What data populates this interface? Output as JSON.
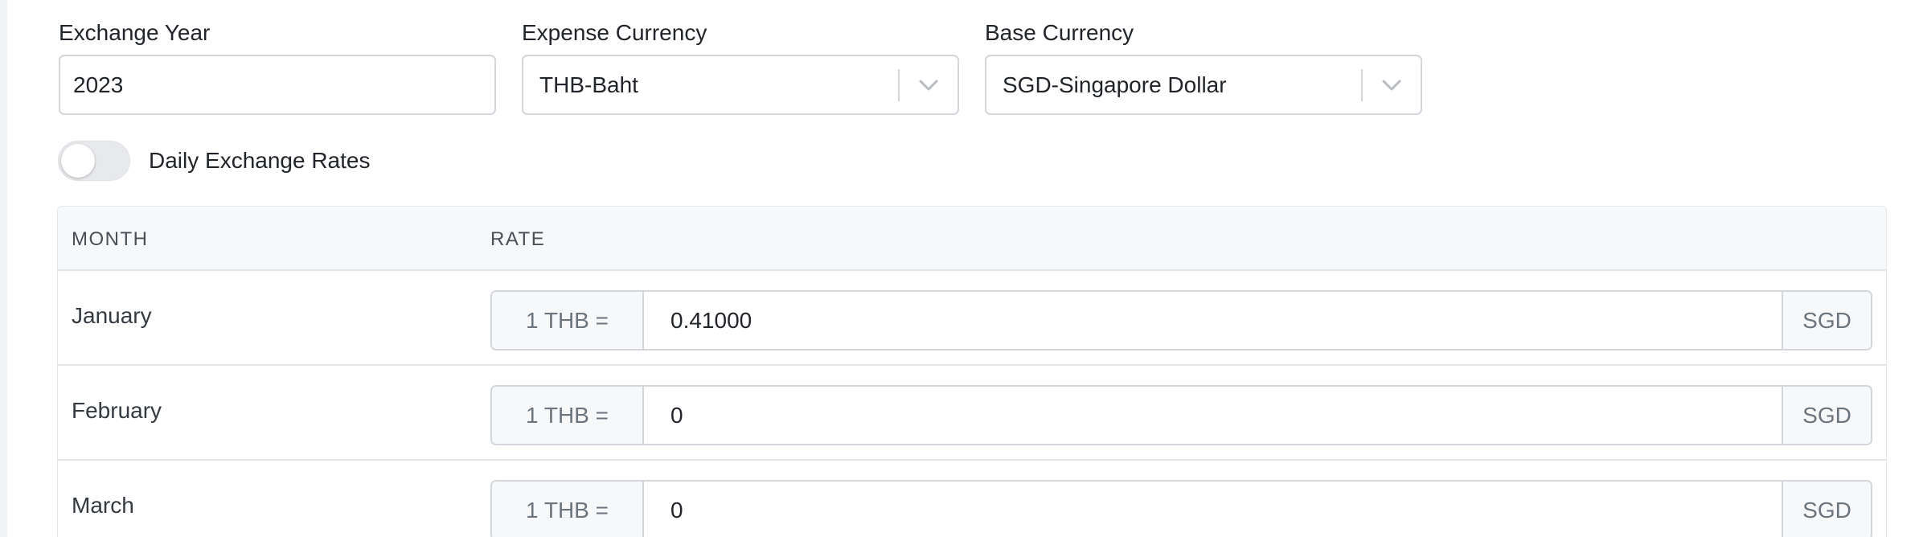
{
  "form": {
    "exchange_year": {
      "label": "Exchange Year",
      "value": "2023"
    },
    "expense_currency": {
      "label": "Expense Currency",
      "selected": "THB-Baht",
      "icon": "chevron-down-icon"
    },
    "base_currency": {
      "label": "Base Currency",
      "selected": "SGD-Singapore Dollar",
      "icon": "chevron-down-icon"
    },
    "daily_rates_toggle": {
      "label": "Daily Exchange Rates",
      "enabled": false
    }
  },
  "table": {
    "columns": [
      "MONTH",
      "RATE"
    ],
    "rows": [
      {
        "month": "January",
        "prefix": "1 THB =",
        "rate": "0.41000",
        "suffix": "SGD"
      },
      {
        "month": "February",
        "prefix": "1 THB =",
        "rate": "0",
        "suffix": "SGD"
      },
      {
        "month": "March",
        "prefix": "1 THB =",
        "rate": "0",
        "suffix": "SGD"
      }
    ]
  },
  "colors": {
    "border": "#d3d6da",
    "addon_background": "#f7f8fa",
    "muted_text": "#6c757d",
    "chevron": "#b8bcc2"
  }
}
